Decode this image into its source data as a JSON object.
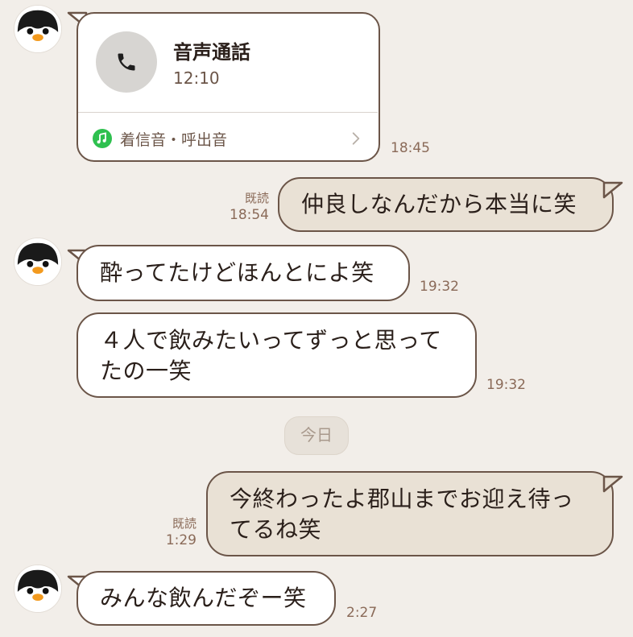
{
  "messages": {
    "call": {
      "title": "音声通話",
      "duration": "12:10",
      "ringtone_label": "着信音・呼出音",
      "time": "18:45",
      "icon": "phone-icon"
    },
    "m1": {
      "text": "仲良しなんだから本当に笑",
      "read": "既読",
      "time": "18:54"
    },
    "m2": {
      "text": "酔ってたけどほんとによ笑",
      "time": "19:32"
    },
    "m3": {
      "line1": "４人で飲みたいってずっと思って",
      "line2": "たの一笑",
      "time": "19:32"
    },
    "date_separator": "今日",
    "m4": {
      "line1": "今終わったよ郡山までお迎え待っ",
      "line2": "てるね笑",
      "read": "既読",
      "time": "1:29"
    },
    "m5": {
      "text": "みんな飲んだぞー笑",
      "time": "2:27"
    }
  },
  "colors": {
    "background": "#f2eee9",
    "incoming_bubble": "#ffffff",
    "outgoing_bubble": "#e9e1d5",
    "bubble_border": "#6b5548",
    "music_green": "#2ec04f"
  }
}
